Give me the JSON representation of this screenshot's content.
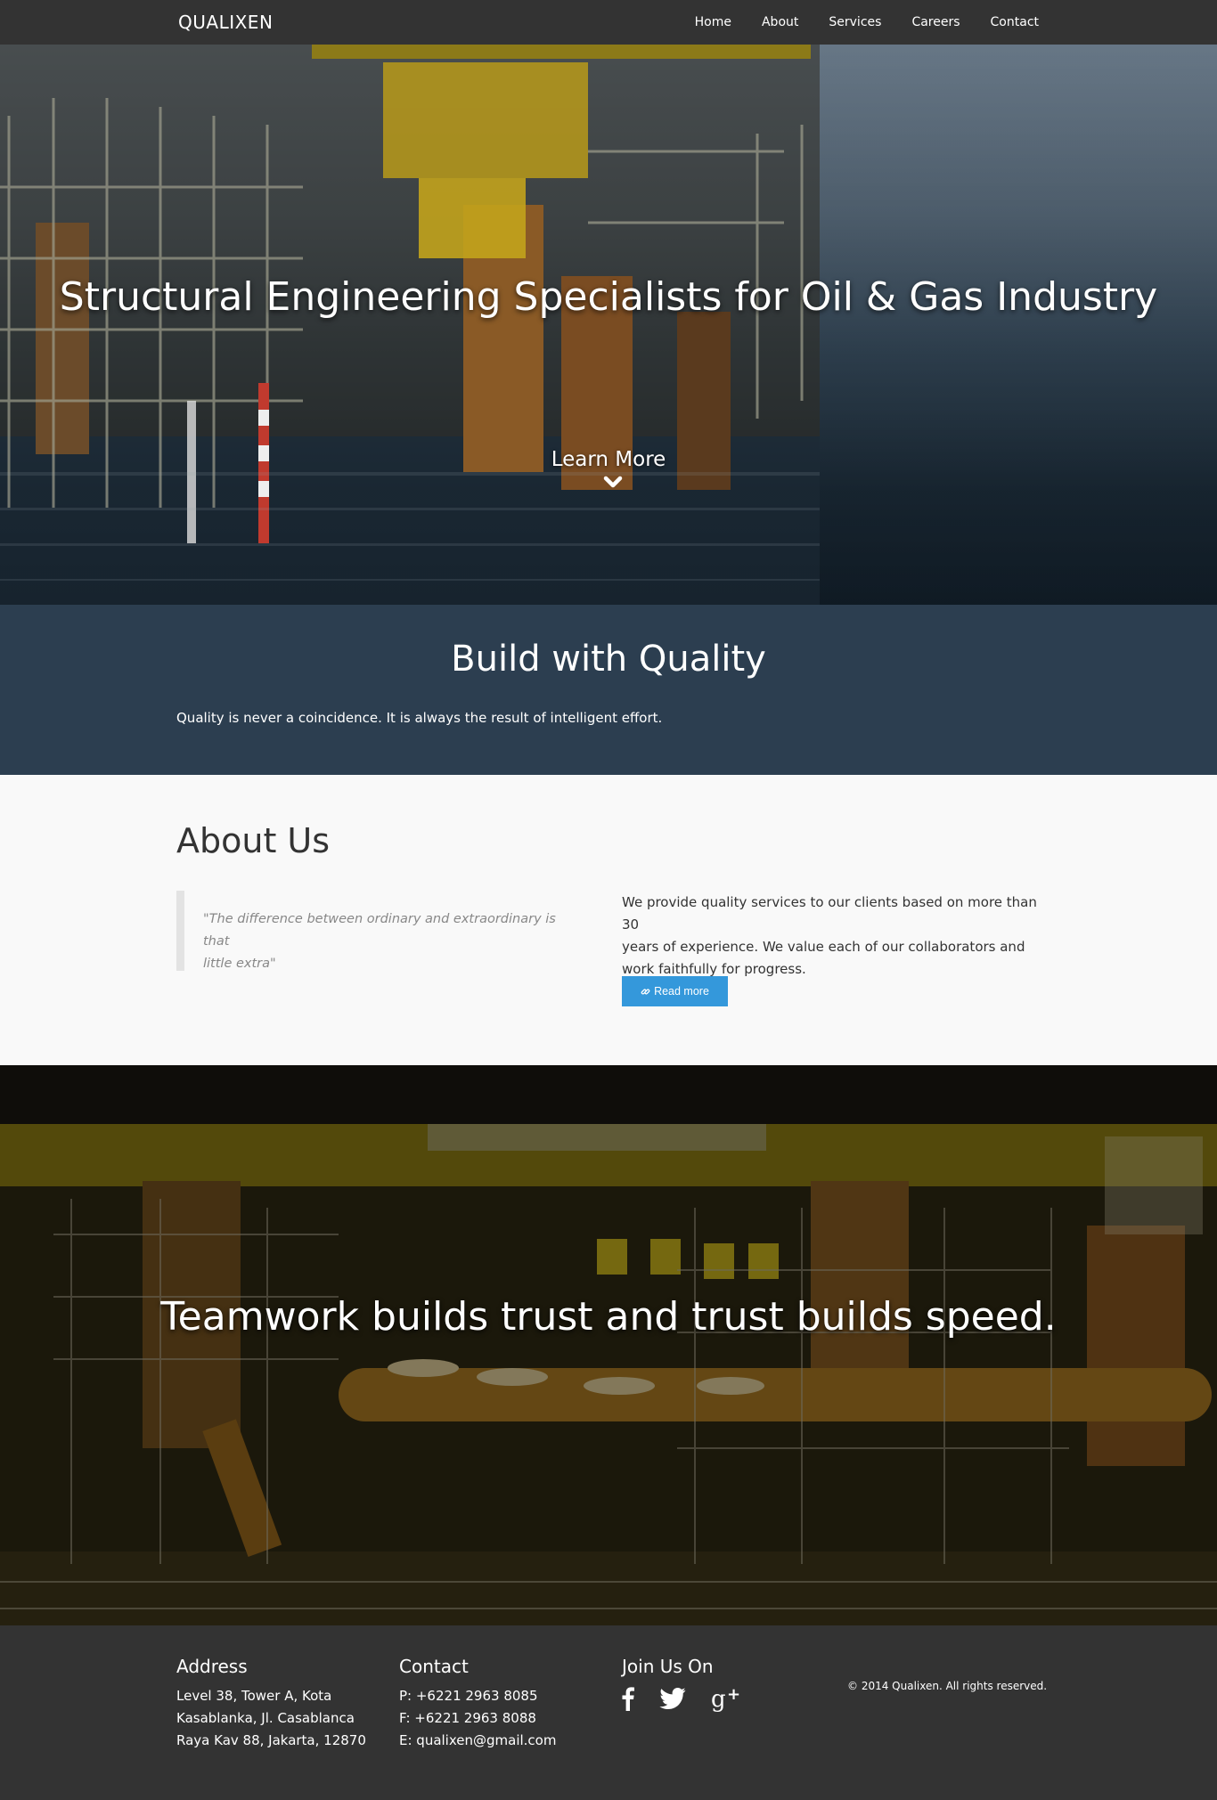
{
  "nav": {
    "brand": "QUALIXEN",
    "items": [
      {
        "label": "Home"
      },
      {
        "label": "About"
      },
      {
        "label": "Services"
      },
      {
        "label": "Careers"
      },
      {
        "label": "Contact"
      }
    ]
  },
  "hero": {
    "title": "Structural Engineering Specialists for Oil & Gas Industry",
    "cta_label": "Learn More",
    "cta_icon": "chevron-down-icon"
  },
  "quality": {
    "title": "Build with Quality",
    "text": "Quality is never a coincidence. It is always the result of intelligent effort."
  },
  "about": {
    "title": "About Us",
    "quote_line1": "\"The difference between ordinary and extraordinary is that",
    "quote_line2": "little extra\"",
    "text_line1": "We provide quality services to our clients based on more than 30",
    "text_line2": "years of experience. We value each of our collaborators and",
    "text_line3": "work faithfully for progress.",
    "button_label": "Read more",
    "button_icon": "link-icon",
    "button_color": "#3498db"
  },
  "parallax": {
    "title": "Teamwork builds trust and trust builds speed."
  },
  "footer": {
    "address": {
      "title": "Address",
      "lines": [
        "Level 38, Tower A, Kota",
        "Kasablanka, Jl. Casablanca",
        "Raya Kav 88, Jakarta, 12870"
      ]
    },
    "contact": {
      "title": "Contact",
      "lines": [
        "P: +6221 2963 8085",
        "F: +6221 2963 8088",
        "E: qualixen@gmail.com"
      ]
    },
    "social": {
      "title": "Join Us On",
      "icons": [
        "facebook-icon",
        "twitter-icon",
        "google-plus-icon"
      ]
    },
    "copyright": "© 2014 Qualixen. All rights reserved."
  },
  "colors": {
    "navbar": "#333333",
    "quality_band": "#2c3e50",
    "about_bg": "#f9f9f9",
    "footer": "#333333",
    "accent": "#3498db"
  }
}
